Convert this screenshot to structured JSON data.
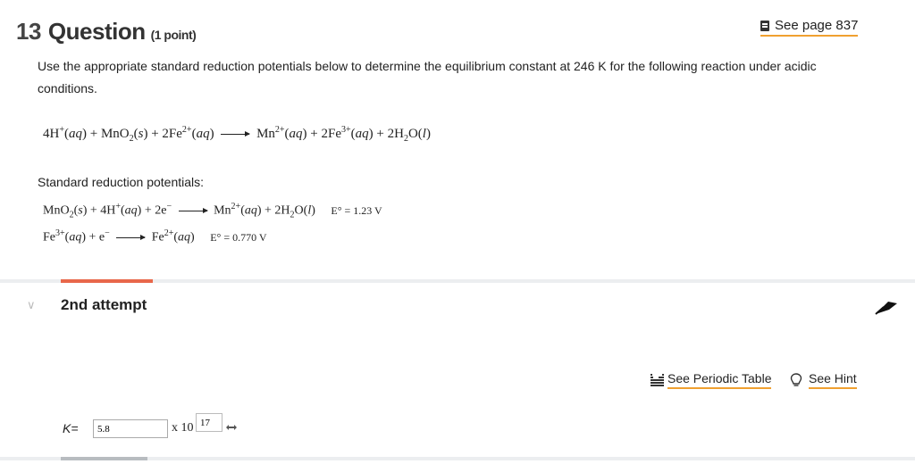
{
  "question": {
    "number": "13",
    "title": "Question",
    "points": "(1 point)"
  },
  "see_page": "See page 837",
  "prompt": "Use the appropriate standard reduction potentials below to determine the equilibrium constant at 246 K for the following reaction under acidic conditions.",
  "reaction": {
    "reactants": [
      "4H",
      "+",
      "(aq)",
      " + MnO",
      "2",
      "(s)",
      " + 2Fe",
      "2+",
      "(aq)"
    ],
    "products": [
      "Mn",
      "2+",
      "(aq)",
      " + 2Fe",
      "3+",
      "(aq)",
      " + 2H",
      "2",
      "O",
      "(l)"
    ]
  },
  "potentials_label": "Standard reduction potentials:",
  "half_reactions": [
    {
      "lhs": "MnO2(s) + 4H+(aq) + 2e−",
      "rhs": "Mn2+(aq) + 2H2O(l)",
      "E": "E° = 1.23 V"
    },
    {
      "lhs": "Fe3+(aq) + e−",
      "rhs": "Fe2+(aq)",
      "E": "E° = 0.770 V"
    }
  ],
  "attempt_label": "2nd attempt",
  "links": {
    "periodic_table": "See Periodic Table",
    "hint": "See Hint"
  },
  "answer": {
    "k_label": "K=",
    "mantissa": "5.8",
    "times_ten": "x 10",
    "exponent": "17"
  },
  "colors": {
    "accent_orange": "#f0a030",
    "tab_red": "#e8674a"
  }
}
